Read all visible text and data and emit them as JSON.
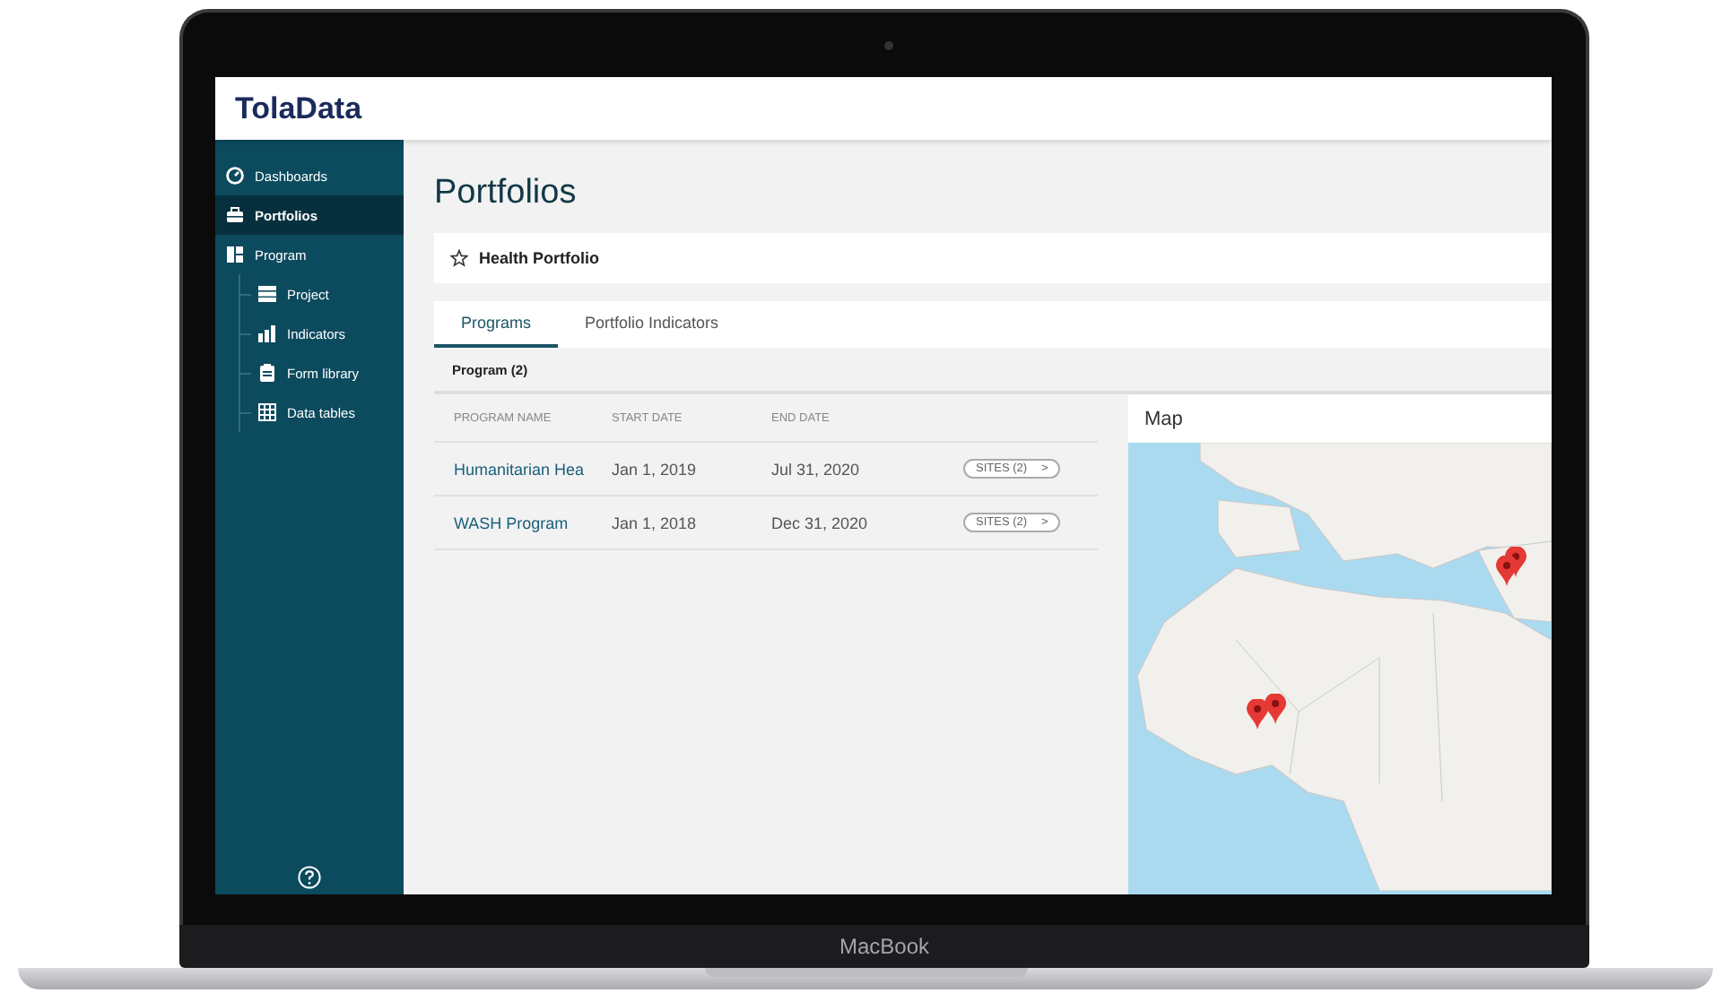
{
  "header": {
    "logo": "TolaData"
  },
  "sidebar": {
    "items": [
      {
        "label": "Dashboards",
        "selected": false
      },
      {
        "label": "Portfolios",
        "selected": true
      },
      {
        "label": "Program",
        "selected": false,
        "children": [
          {
            "label": "Project",
            "selected": false
          },
          {
            "label": "Indicators",
            "selected": false
          },
          {
            "label": "Form library",
            "selected": false
          },
          {
            "label": "Data tables",
            "selected": false
          }
        ]
      }
    ]
  },
  "page_title": "Portfolios",
  "portfolio": {
    "name": "Health Portfolio"
  },
  "tabs": [
    {
      "label": "Programs",
      "selected": true
    },
    {
      "label": "Portfolio Indicators",
      "selected": false
    }
  ],
  "section_label": "Program (2)",
  "table": {
    "columns": [
      "PROGRAM NAME",
      "START DATE",
      "END DATE"
    ],
    "rows": [
      {
        "name": "Humanitarian Hea",
        "start": "Jan 1, 2019",
        "end": "Jul 31, 2020",
        "sites": "SITES (2)",
        "arrow": ">"
      },
      {
        "name": "WASH Program",
        "start": "Jan 1, 2018",
        "end": "Dec 31, 2020",
        "sites": "SITES (2)",
        "arrow": ">"
      }
    ]
  },
  "map": {
    "title": "Map"
  },
  "device": {
    "label": "MacBook"
  }
}
